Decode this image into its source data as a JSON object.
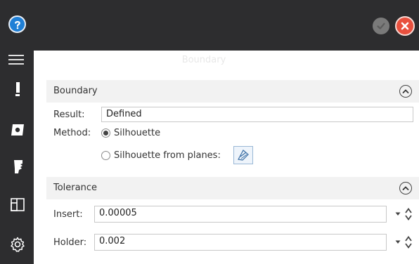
{
  "window": {
    "title": "Boundary",
    "colors": {
      "chrome": "#2d2d2f",
      "accent": "#1f7fd6",
      "cancel": "#e8503e",
      "panel_header": "#f2f2f2"
    }
  },
  "titlebar": {
    "help_icon": "question-circle-icon",
    "ok_icon": "check-circle-icon",
    "cancel_icon": "close-circle-icon",
    "menu_icon": "hamburger-menu-icon"
  },
  "sidebar": {
    "items": [
      {
        "icon": "tool-icon"
      },
      {
        "icon": "boundary-icon"
      },
      {
        "icon": "holder-icon"
      },
      {
        "icon": "stock-icon"
      },
      {
        "icon": "settings-icon"
      }
    ]
  },
  "boundary_group": {
    "title": "Boundary",
    "result_label": "Result:",
    "result_value": "Defined",
    "method_label": "Method:",
    "options": [
      {
        "label": "Silhouette",
        "selected": true
      },
      {
        "label": "Silhouette from planes:",
        "selected": false
      }
    ]
  },
  "tolerance_group": {
    "title": "Tolerance",
    "insert_label": "Insert:",
    "insert_value": "0.00005",
    "holder_label": "Holder:",
    "holder_value": "0.002"
  }
}
